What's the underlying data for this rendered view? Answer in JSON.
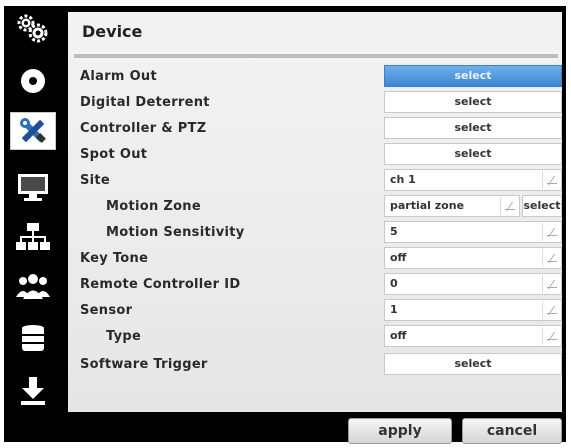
{
  "panel": {
    "title": "Device"
  },
  "sidebar": {
    "items": [
      {
        "icon": "gears-icon"
      },
      {
        "icon": "disc-icon"
      },
      {
        "icon": "tools-icon",
        "active": true
      },
      {
        "icon": "monitor-icon"
      },
      {
        "icon": "network-icon"
      },
      {
        "icon": "users-icon"
      },
      {
        "icon": "database-icon"
      },
      {
        "icon": "download-icon"
      }
    ]
  },
  "rows": {
    "alarm_out": {
      "label": "Alarm Out",
      "button": "select"
    },
    "digital_deterrent": {
      "label": "Digital Deterrent",
      "button": "select"
    },
    "controller_ptz": {
      "label": "Controller & PTZ",
      "button": "select"
    },
    "spot_out": {
      "label": "Spot Out",
      "button": "select"
    },
    "site": {
      "label": "Site",
      "value": "ch 1"
    },
    "motion_zone": {
      "label": "Motion Zone",
      "value": "partial zone",
      "button": "select"
    },
    "motion_sensitivity": {
      "label": "Motion Sensitivity",
      "value": "5"
    },
    "key_tone": {
      "label": "Key Tone",
      "value": "off"
    },
    "remote_controller_id": {
      "label": "Remote Controller ID",
      "value": "0"
    },
    "sensor": {
      "label": "Sensor",
      "value": "1"
    },
    "type": {
      "label": "Type",
      "value": "off"
    },
    "software_trigger": {
      "label": "Software Trigger",
      "button": "select"
    }
  },
  "footer": {
    "apply": "apply",
    "cancel": "cancel"
  },
  "colors": {
    "selected": "#4a94dc",
    "panel": "#ececec",
    "frame": "#000000"
  }
}
